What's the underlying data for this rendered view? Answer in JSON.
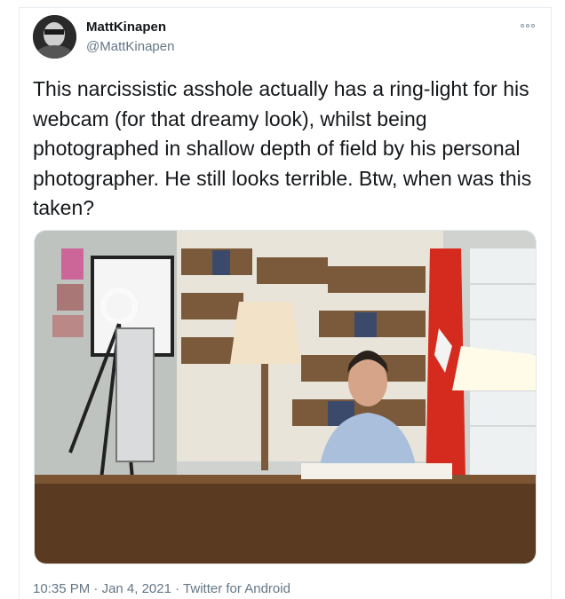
{
  "author": {
    "display_name": "MattKinapen",
    "handle": "@MattKinapen"
  },
  "tweet": {
    "text": "This narcissistic asshole actually has a ring-light for his webcam (for that dreamy look), whilst being photographed in shallow depth of field by his personal photographer. He still looks terrible. Btw, when was this taken?",
    "time": "10:35 PM",
    "date": "Jan 4, 2021",
    "separator": "·",
    "source": "Twitter for Android"
  },
  "icons": {
    "more": "more-options-icon"
  },
  "colors": {
    "text_primary": "#14171a",
    "text_secondary": "#657786",
    "border": "#e6ecf0",
    "flag_red": "#d52b1e"
  }
}
